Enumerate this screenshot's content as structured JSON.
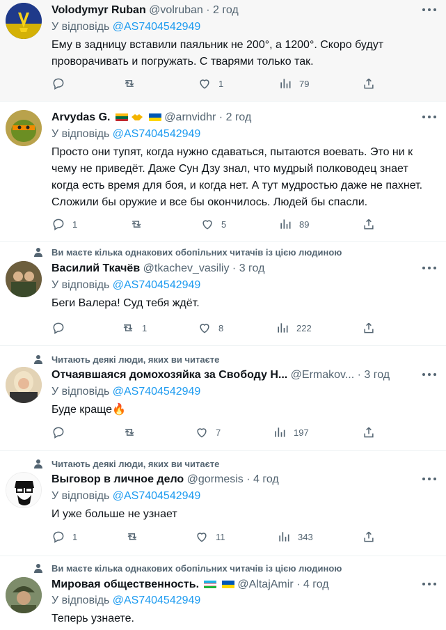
{
  "tweets": [
    {
      "name": "Volodymyr Ruban",
      "handle": "@volruban",
      "time": "2 год",
      "reply_prefix": "У відповідь",
      "mention": "@AS7404542949",
      "text": "Ему в задницу вставили паяльник не 200°, а 1200°. Скоро будут проворачивать и погружать. С тварями только так.",
      "replies": "",
      "retweets": "",
      "likes": "1",
      "views": "79",
      "flags": []
    },
    {
      "name": "Arvydas G.",
      "handle": "@arnvidhr",
      "time": "2 год",
      "reply_prefix": "У відповідь",
      "mention": "@AS7404542949",
      "text": "Просто они тупят, когда нужно сдаваться, пытаются воевать. Это ни к чему не приведёт. Даже Сун Дзу знал, что мудрый полководец знает когда есть время для боя, и когда нет. А тут мудростью даже не пахнет. Сложили бы оружие и все бы окончилось. Людей бы спасли.",
      "replies": "1",
      "retweets": "",
      "likes": "5",
      "views": "89",
      "flags": [
        "lithuania-flag",
        "handshake-emoji",
        "ukraine-flag"
      ]
    },
    {
      "social": "Ви маєте кілька однакових обопільних читачів із цією людиною",
      "name": "Василий Ткачёв",
      "handle": "@tkachev_vasiliy",
      "time": "3 год",
      "reply_prefix": "У відповідь",
      "mention": "@AS7404542949",
      "text": "Беги Валера! Суд тебя ждёт.",
      "replies": "",
      "retweets": "1",
      "likes": "8",
      "views": "222",
      "flags": []
    },
    {
      "social": "Читають деякі люди, яких ви читаєте",
      "name": "Отчаявшаяся домохозяйка за Свободу Н...",
      "handle": "@Ermakov...",
      "time": "3 год",
      "reply_prefix": "У відповідь",
      "mention": "@AS7404542949",
      "text": "Буде краще🔥",
      "replies": "",
      "retweets": "",
      "likes": "7",
      "views": "197",
      "flags": []
    },
    {
      "social": "Читають деякі люди, яких ви читаєте",
      "name": "Выговор в личное дело",
      "handle": "@gormesis",
      "time": "4 год",
      "reply_prefix": "У відповідь",
      "mention": "@AS7404542949",
      "text": "И уже больше не узнает",
      "replies": "1",
      "retweets": "",
      "likes": "11",
      "views": "343",
      "flags": []
    },
    {
      "social": "Ви маєте кілька однакових обопільних читачів із цією людиною",
      "name": "Мировая общественность.",
      "handle": "@AltajAmir",
      "time": "4 год",
      "reply_prefix": "У відповідь",
      "mention": "@AS7404542949",
      "text": "Теперь узнаете.",
      "flags": [
        "uzbekistan-flag",
        "ukraine-flag"
      ]
    }
  ],
  "colors": {
    "accent": "#1d9bf0",
    "secondary_text": "#536471",
    "ukraine_blue": "#0057b7",
    "ukraine_yellow": "#ffd700"
  },
  "icons": [
    "reply-icon",
    "retweet-icon",
    "like-icon",
    "views-icon",
    "share-icon",
    "more-icon",
    "person-icon"
  ],
  "dot": "·"
}
